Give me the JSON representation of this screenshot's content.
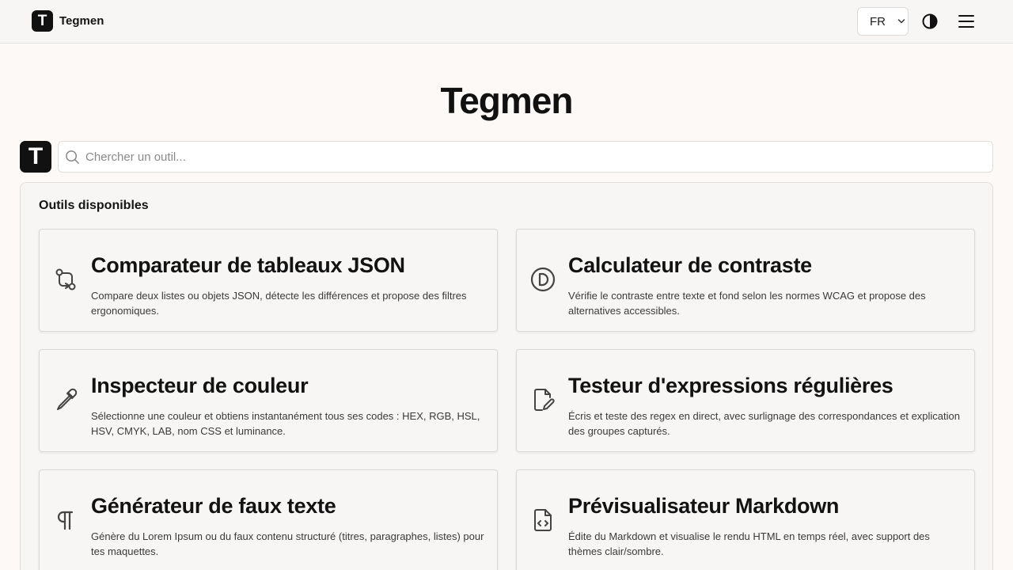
{
  "header": {
    "brand_name": "Tegmen",
    "brand_logo_letter": "T",
    "language": "FR"
  },
  "hero": {
    "title": "Tegmen"
  },
  "search": {
    "logo_letter": "T",
    "placeholder": "Chercher un outil...",
    "value": ""
  },
  "tools": {
    "section_title": "Outils disponibles",
    "items": [
      {
        "title": "Comparateur de tableaux JSON",
        "description": "Compare deux listes ou objets JSON, détecte les différences et propose des filtres ergonomiques.",
        "icon": "git-compare-icon"
      },
      {
        "title": "Calculateur de contraste",
        "description": "Vérifie le contraste entre texte et fond selon les normes WCAG et propose des alternatives accessibles.",
        "icon": "contrast-icon"
      },
      {
        "title": "Inspecteur de couleur",
        "description": "Sélectionne une couleur et obtiens instantanément tous ses codes : HEX, RGB, HSL, HSV, CMYK, LAB, nom CSS et luminance.",
        "icon": "eyedropper-icon"
      },
      {
        "title": "Testeur d'expressions régulières",
        "description": "Écris et teste des regex en direct, avec surlignage des correspondances et explication des groupes capturés.",
        "icon": "file-edit-icon"
      },
      {
        "title": "Générateur de faux texte",
        "description": "Génère du Lorem Ipsum ou du faux contenu structuré (titres, paragraphes, listes) pour tes maquettes.",
        "icon": "pilcrow-icon"
      },
      {
        "title": "Prévisualisateur Markdown",
        "description": "Édite du Markdown et visualise le rendu HTML en temps réel, avec support des thèmes clair/sombre.",
        "icon": "file-code-icon"
      }
    ]
  },
  "colors": {
    "background": "#fcf9f6",
    "surface": "#f7f6f4",
    "text": "#141414",
    "logo": "#111111"
  }
}
